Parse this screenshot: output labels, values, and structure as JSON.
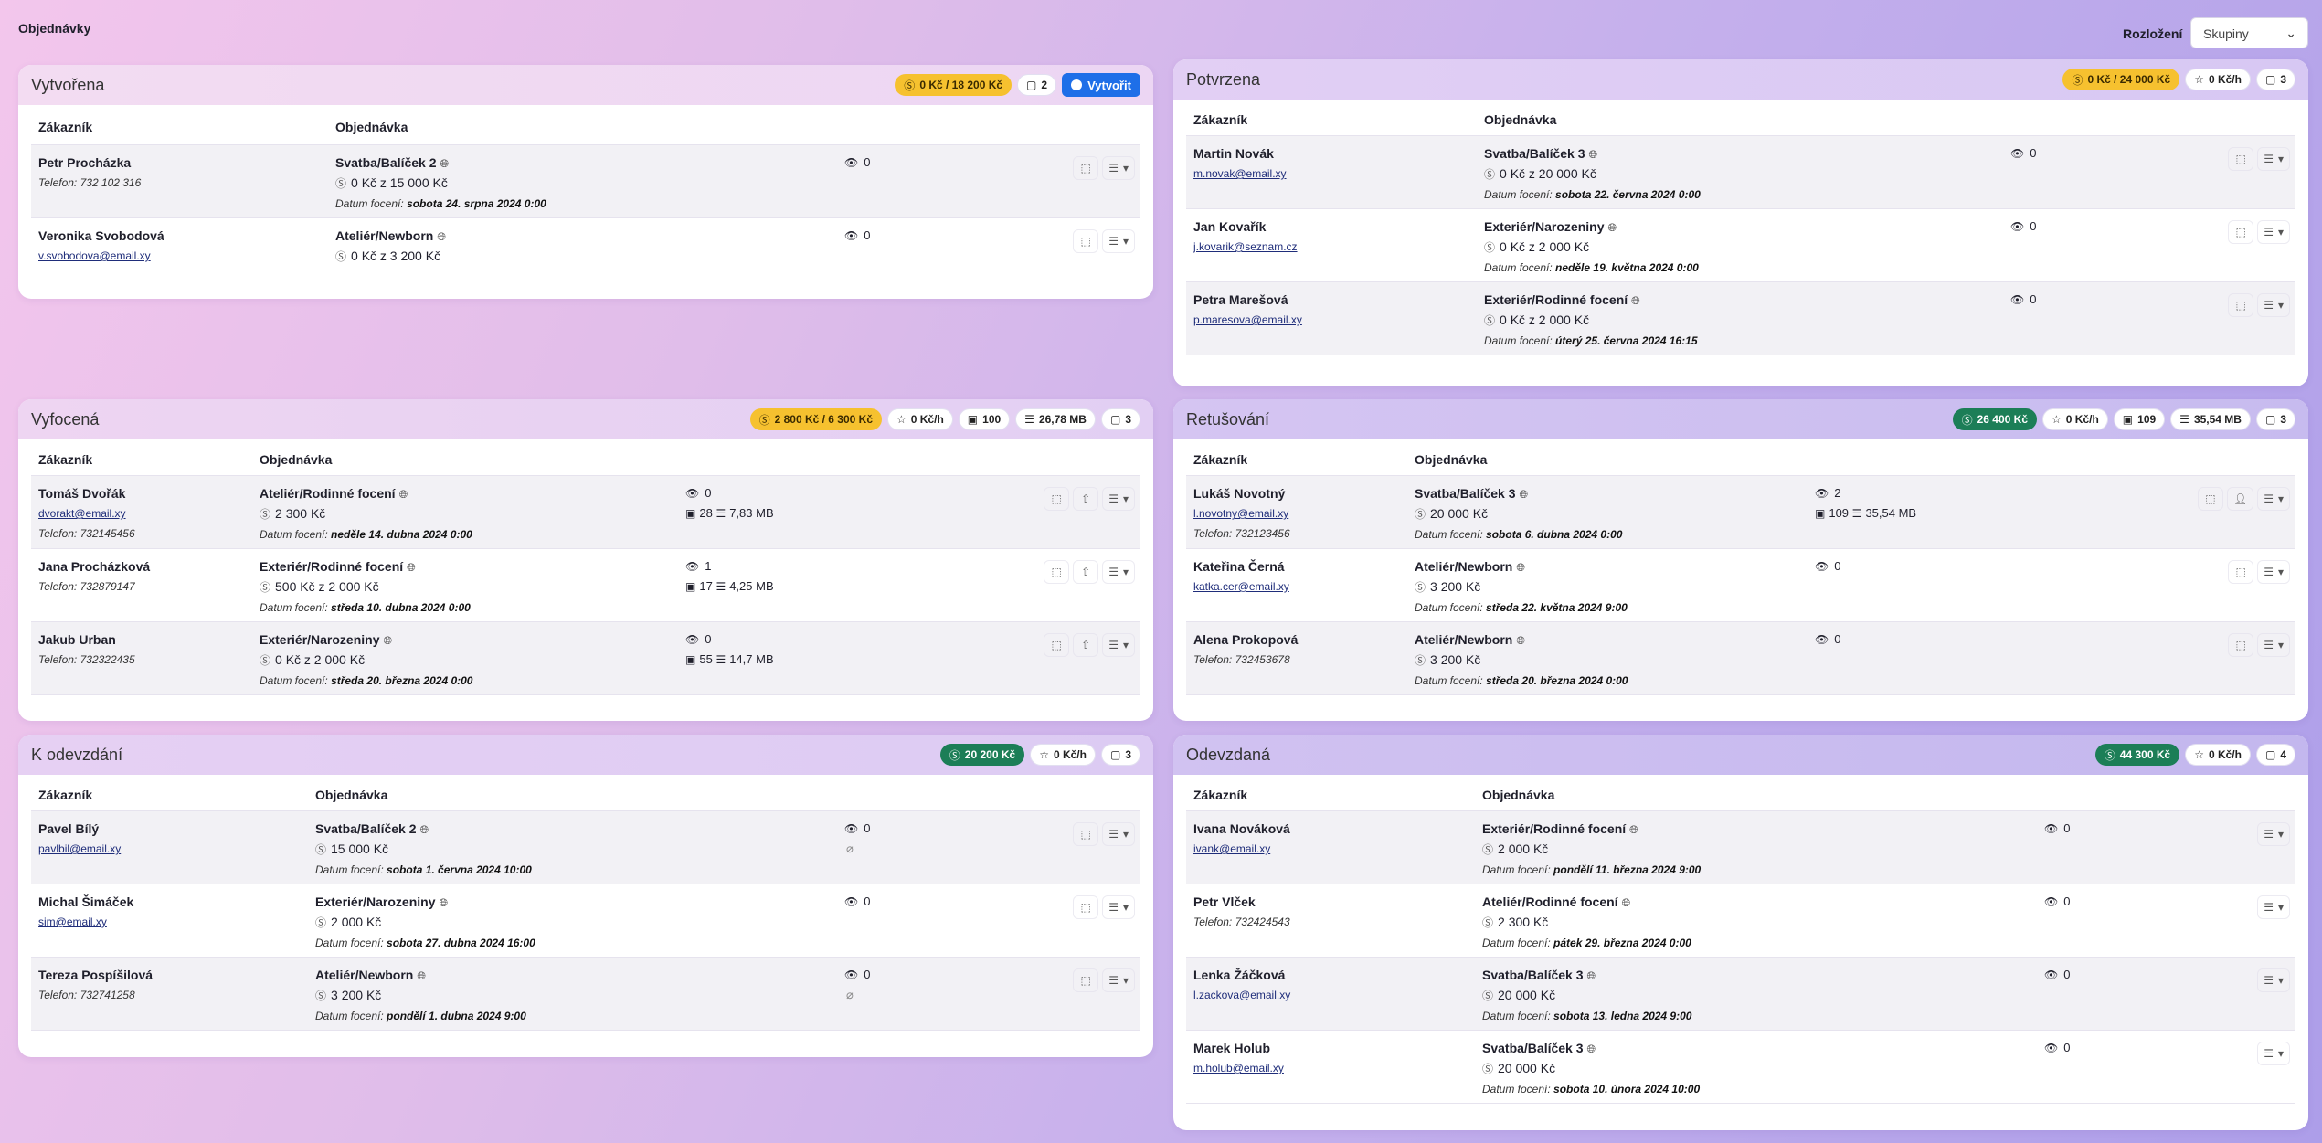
{
  "app_title": "Objednávky",
  "layout": {
    "label": "Rozložení",
    "selected": "Skupiny"
  },
  "panels": {
    "vytvorena": {
      "title": "Vytvořena",
      "badge_money": "0 Kč / 18 200 Kč",
      "badge_count": "2",
      "create_label": "Vytvořit",
      "col_customer": "Zákazník",
      "col_order": "Objednávka",
      "rows": [
        {
          "name": "Petr Procházka",
          "sub": "Telefon: 732 102 316",
          "type": "Svatba/Balíček 2",
          "money": "0 Kč z 15 000 Kč",
          "date_label": "Datum focení:",
          "date": "sobota 24. srpna 2024 0:00",
          "views": "0"
        },
        {
          "name": "Veronika Svobodová",
          "sub": "v.svobodova@email.xy",
          "type": "Ateliér/Newborn",
          "money": "0 Kč z 3 200 Kč",
          "views": "0"
        }
      ]
    },
    "potvrzena": {
      "title": "Potvrzena",
      "badge_money": "0 Kč / 24 000 Kč",
      "badge_rate": "0 Kč/h",
      "badge_count": "3",
      "col_customer": "Zákazník",
      "col_order": "Objednávka",
      "rows": [
        {
          "name": "Martin Novák",
          "sub": "m.novak@email.xy",
          "type": "Svatba/Balíček 3",
          "money": "0 Kč z 20 000 Kč",
          "date_label": "Datum focení:",
          "date": "sobota 22. června 2024 0:00",
          "views": "0"
        },
        {
          "name": "Jan Kovařík",
          "sub": "j.kovarik@seznam.cz",
          "type": "Exteriér/Narozeniny",
          "money": "0 Kč z 2 000 Kč",
          "date_label": "Datum focení:",
          "date": "neděle 19. května 2024 0:00",
          "views": "0"
        },
        {
          "name": "Petra Marešová",
          "sub": "p.maresova@email.xy",
          "type": "Exteriér/Rodinné focení",
          "money": "0 Kč z 2 000 Kč",
          "date_label": "Datum focení:",
          "date": "úterý 25. června 2024 16:15",
          "views": "0"
        }
      ]
    },
    "vyfocena": {
      "title": "Vyfocená",
      "badge_money": "2 800 Kč / 6 300 Kč",
      "badge_rate": "0 Kč/h",
      "badge_photos": "100",
      "badge_size": "26,78 MB",
      "badge_count": "3",
      "col_customer": "Zákazník",
      "col_order": "Objednávka",
      "rows": [
        {
          "name": "Tomáš Dvořák",
          "sub": "dvorakt@email.xy",
          "sub2": "Telefon: 732145456",
          "type": "Ateliér/Rodinné focení",
          "money": "2 300 Kč",
          "date_label": "Datum focení:",
          "date": "neděle 14. dubna 2024 0:00",
          "views": "0",
          "photos": "28",
          "size": "7,83 MB"
        },
        {
          "name": "Jana Procházková",
          "sub": "Telefon: 732879147",
          "type": "Exteriér/Rodinné focení",
          "money": "500 Kč z 2 000 Kč",
          "date_label": "Datum focení:",
          "date": "středa 10. dubna 2024 0:00",
          "views": "1",
          "photos": "17",
          "size": "4,25 MB"
        },
        {
          "name": "Jakub Urban",
          "sub": "Telefon: 732322435",
          "type": "Exteriér/Narozeniny",
          "money": "0 Kč z 2 000 Kč",
          "date_label": "Datum focení:",
          "date": "středa 20. března 2024 0:00",
          "views": "0",
          "photos": "55",
          "size": "14,7 MB"
        }
      ]
    },
    "retusovani": {
      "title": "Retušování",
      "badge_money": "26 400 Kč",
      "badge_rate": "0 Kč/h",
      "badge_photos": "109",
      "badge_size": "35,54 MB",
      "badge_count": "3",
      "col_customer": "Zákazník",
      "col_order": "Objednávka",
      "rows": [
        {
          "name": "Lukáš Novotný",
          "sub": "l.novotny@email.xy",
          "sub2": "Telefon: 732123456",
          "type": "Svatba/Balíček 3",
          "money": "20 000 Kč",
          "date_label": "Datum focení:",
          "date": "sobota 6. dubna 2024 0:00",
          "views": "2",
          "photos": "109",
          "size": "35,54 MB"
        },
        {
          "name": "Kateřina Černá",
          "sub": "katka.cer@email.xy",
          "type": "Ateliér/Newborn",
          "money": "3 200 Kč",
          "date_label": "Datum focení:",
          "date": "středa 22. května 2024 9:00",
          "views": "0"
        },
        {
          "name": "Alena Prokopová",
          "sub": "Telefon: 732453678",
          "type": "Ateliér/Newborn",
          "money": "3 200 Kč",
          "date_label": "Datum focení:",
          "date": "středa 20. března 2024 0:00",
          "views": "0"
        }
      ]
    },
    "kodevzdani": {
      "title": "K odevzdání",
      "badge_money": "20 200 Kč",
      "badge_rate": "0 Kč/h",
      "badge_count": "3",
      "col_customer": "Zákazník",
      "col_order": "Objednávka",
      "rows": [
        {
          "name": "Pavel Bílý",
          "sub": "pavlbil@email.xy",
          "type": "Svatba/Balíček 2",
          "money": "15 000 Kč",
          "date_label": "Datum focení:",
          "date": "sobota 1. června 2024 10:00",
          "views": "0"
        },
        {
          "name": "Michal Šimáček",
          "sub": "sim@email.xy",
          "type": "Exteriér/Narozeniny",
          "money": "2 000 Kč",
          "date_label": "Datum focení:",
          "date": "sobota 27. dubna 2024 16:00",
          "views": "0"
        },
        {
          "name": "Tereza Pospíšilová",
          "sub": "Telefon: 732741258",
          "type": "Ateliér/Newborn",
          "money": "3 200 Kč",
          "date_label": "Datum focení:",
          "date": "pondělí 1. dubna 2024 9:00",
          "views": "0"
        }
      ]
    },
    "odevzdana": {
      "title": "Odevzdaná",
      "badge_money": "44 300 Kč",
      "badge_rate": "0 Kč/h",
      "badge_count": "4",
      "col_customer": "Zákazník",
      "col_order": "Objednávka",
      "rows": [
        {
          "name": "Ivana Nováková",
          "sub": "ivank@email.xy",
          "type": "Exteriér/Rodinné focení",
          "money": "2 000 Kč",
          "date_label": "Datum focení:",
          "date": "pondělí 11. března 2024 9:00",
          "views": "0"
        },
        {
          "name": "Petr Vlček",
          "sub": "Telefon: 732424543",
          "type": "Ateliér/Rodinné focení",
          "money": "2 300 Kč",
          "date_label": "Datum focení:",
          "date": "pátek 29. března 2024 0:00",
          "views": "0"
        },
        {
          "name": "Lenka Žáčková",
          "sub": "l.zackova@email.xy",
          "type": "Svatba/Balíček 3",
          "money": "20 000 Kč",
          "date_label": "Datum focení:",
          "date": "sobota 13. ledna 2024 9:00",
          "views": "0"
        },
        {
          "name": "Marek Holub",
          "sub": "m.holub@email.xy",
          "type": "Svatba/Balíček 3",
          "money": "20 000 Kč",
          "date_label": "Datum focení:",
          "date": "sobota 10. února 2024 10:00",
          "views": "0"
        }
      ]
    }
  },
  "colors": {
    "pending": "#f6c12f",
    "done": "#1c7e57",
    "primary": "#1e6fe8"
  },
  "icons": [
    "coin-icon",
    "bag-icon",
    "star-icon",
    "image-icon",
    "database-icon",
    "globe-icon",
    "eye-icon",
    "tag-icon",
    "upload-icon",
    "list-icon",
    "chevron-down-icon",
    "user-icon",
    "paperclip-icon"
  ]
}
